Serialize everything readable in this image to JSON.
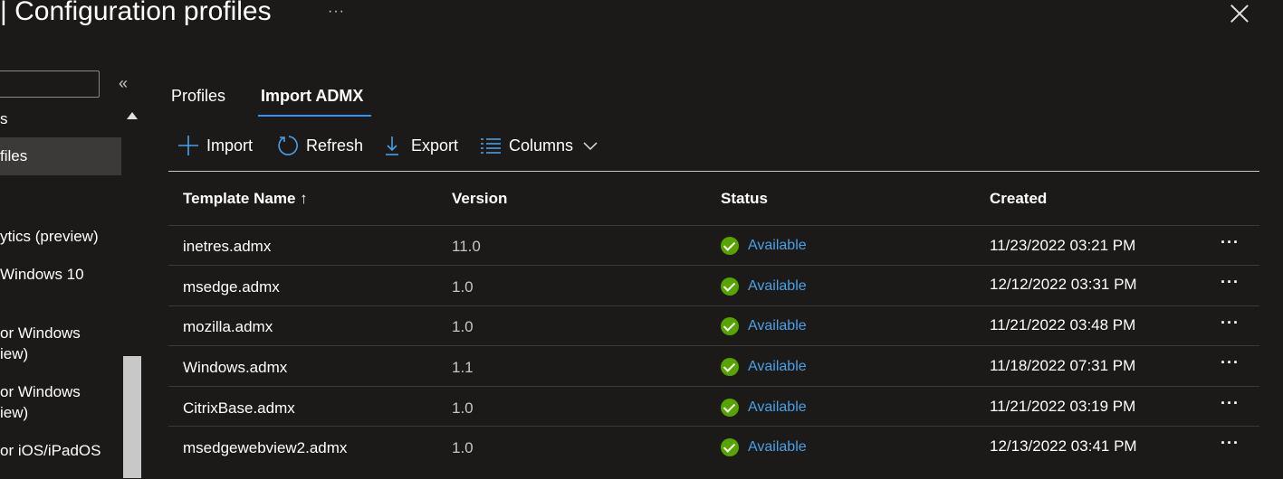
{
  "header": {
    "title": "| Configuration profiles",
    "more_label": "···"
  },
  "nav": {
    "items": [
      {
        "label": "s",
        "selected": false
      },
      {
        "label": "files",
        "selected": true
      },
      {
        "label": "ytics (preview)",
        "selected": false
      },
      {
        "label": "Windows 10",
        "selected": false
      },
      {
        "label": "or Windows",
        "selected": false
      },
      {
        "label": "iew)",
        "selected": false
      },
      {
        "label": "or Windows",
        "selected": false
      },
      {
        "label": "iew)",
        "selected": false
      },
      {
        "label": "or iOS/iPadOS",
        "selected": false
      }
    ]
  },
  "tabs": [
    {
      "label": "Profiles",
      "active": false
    },
    {
      "label": "Import ADMX",
      "active": true
    }
  ],
  "toolbar": {
    "import": "Import",
    "refresh": "Refresh",
    "export": "Export",
    "columns": "Columns"
  },
  "table": {
    "headers": {
      "name": "Template Name ↑",
      "version": "Version",
      "status": "Status",
      "created": "Created"
    },
    "rows": [
      {
        "name": "inetres.admx",
        "version": "11.0",
        "status": "Available",
        "created": "11/23/2022 03:21 PM"
      },
      {
        "name": "msedge.admx",
        "version": "1.0",
        "status": "Available",
        "created": "12/12/2022 03:31 PM"
      },
      {
        "name": "mozilla.admx",
        "version": "1.0",
        "status": "Available",
        "created": "11/21/2022 03:48 PM"
      },
      {
        "name": "Windows.admx",
        "version": "1.1",
        "status": "Available",
        "created": "11/18/2022 07:31 PM"
      },
      {
        "name": "CitrixBase.admx",
        "version": "1.0",
        "status": "Available",
        "created": "11/21/2022 03:19 PM"
      },
      {
        "name": "msedgewebview2.admx",
        "version": "1.0",
        "status": "Available",
        "created": "12/13/2022 03:41 PM"
      }
    ],
    "row_more_label": "···"
  },
  "colors": {
    "accent": "#2899f5",
    "status_ok": "#57a300",
    "link": "#4aa0e6",
    "background": "#1b1a19"
  }
}
